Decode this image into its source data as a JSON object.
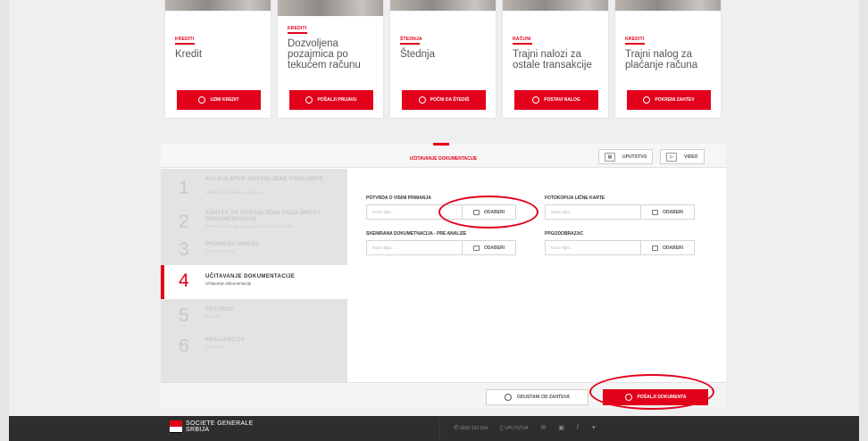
{
  "cards": [
    {
      "category": "KREDITI",
      "title": "Kredit",
      "button": "UZMI KREDIT"
    },
    {
      "category": "KREDITI",
      "title": "Dozvoljena pozajmica po tekućem računu",
      "button": "POŠALJI PRIJAVU"
    },
    {
      "category": "ŠTEDNJA",
      "title": "Štednja",
      "button": "POČNI DA ŠTEDIŠ"
    },
    {
      "category": "RAČUNI",
      "title": "Trajni nalozi za ostale transakcije",
      "button": "POSTAVI NALOG"
    },
    {
      "category": "KREDITI",
      "title": "Trajni nalog za plaćanje računa",
      "button": "POKRENI ZAHTEV"
    }
  ],
  "wizard": {
    "title": "UČITAVANJE DOKUMENTACIJE",
    "tools": {
      "instructions": "UPUTSTVO",
      "video": "VIDEO"
    },
    "steps": [
      {
        "num": "1",
        "title": "KALKULATOR DOZVOLJENE POZAJMICE",
        "sub": "Kalkulator dozvoljene pozajmice"
      },
      {
        "num": "2",
        "title": "ZAHTEV ZA DOZVOLJENU POZAJMICU I DOKUMENTACIJA",
        "sub": "Zahtev za dozvoljenu pozajmicu i dokumentacija"
      },
      {
        "num": "3",
        "title": "PROMENA IZNOSA",
        "sub": "Promena iznosa"
      },
      {
        "num": "4",
        "title": "UČITAVANJE DOKUMENTACIJE",
        "sub": "Učitavanje dokumentacije"
      },
      {
        "num": "5",
        "title": "POTVRDA",
        "sub": "Potvrda"
      },
      {
        "num": "6",
        "title": "REALIZACIJA",
        "sub": "Realizacija"
      }
    ],
    "fields": [
      {
        "label": "POTVRDA O VISINI PRIMANJA",
        "placeholder": "Naziv fajla...",
        "button": "ODABERI"
      },
      {
        "label": "FOTOKOPIJA LIČNE KARTE",
        "placeholder": "Naziv fajla...",
        "button": "ODABERI"
      },
      {
        "label": "SKENIRANA DOKUMETNACIJA - PRE ANALIZE",
        "placeholder": "Naziv fajla...",
        "button": "ODABERI"
      },
      {
        "label": "PPGODOBRAZAC",
        "placeholder": "Naziv fajla...",
        "button": "ODABERI"
      }
    ],
    "cancel": "ODUSTANI OD ZAHTEVA",
    "submit": "POŠALJI DOKUMENTA"
  },
  "footer": {
    "logo_line1": "SOCIETE GENERALE",
    "logo_line2": "SRBIJA",
    "phone": "0800 333 334",
    "instructions": "UPUTSTVA",
    "icons": [
      "phone-icon",
      "document-icon",
      "mail-icon",
      "video-icon",
      "facebook-icon",
      "twitter-icon"
    ]
  },
  "colors": {
    "accent": "#e2001a",
    "footer_bg": "#2e2e2e"
  }
}
